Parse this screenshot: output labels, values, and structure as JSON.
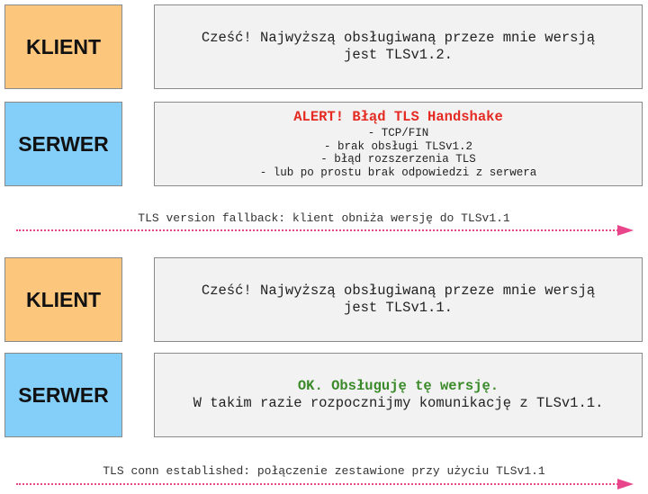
{
  "exchange1": {
    "client_label": "KLIENT",
    "client_message": [
      "Cześć! Najwyższą obsługiwaną przeze mnie wersją",
      "jest TLSv1.2."
    ],
    "server_label": "SERWER",
    "server_alert": "ALERT! Błąd TLS Handshake",
    "server_reasons": [
      "- TCP/FIN",
      "- brak obsługi TLSv1.2",
      "- błąd rozszerzenia TLS",
      "- lub po prostu brak odpowiedzi z serwera"
    ],
    "transition": "TLS version fallback: klient obniża wersję do TLSv1.1"
  },
  "exchange2": {
    "client_label": "KLIENT",
    "client_message": [
      "Cześć! Najwyższą obsługiwaną przeze mnie wersją",
      "jest TLSv1.1."
    ],
    "server_label": "SERWER",
    "server_ok": "OK. Obsługuję tę wersję.",
    "server_message": "W takim razie rozpocznijmy komunikację z TLSv1.1.",
    "transition": "TLS conn established: połączenie zestawione przy użyciu TLSv1.1"
  },
  "colors": {
    "client": "#fcc77c",
    "server": "#84cffa",
    "message_bg": "#f2f2f2",
    "alert": "#e42a22",
    "ok": "#3a8a2a",
    "arrow": "#e8458a"
  }
}
